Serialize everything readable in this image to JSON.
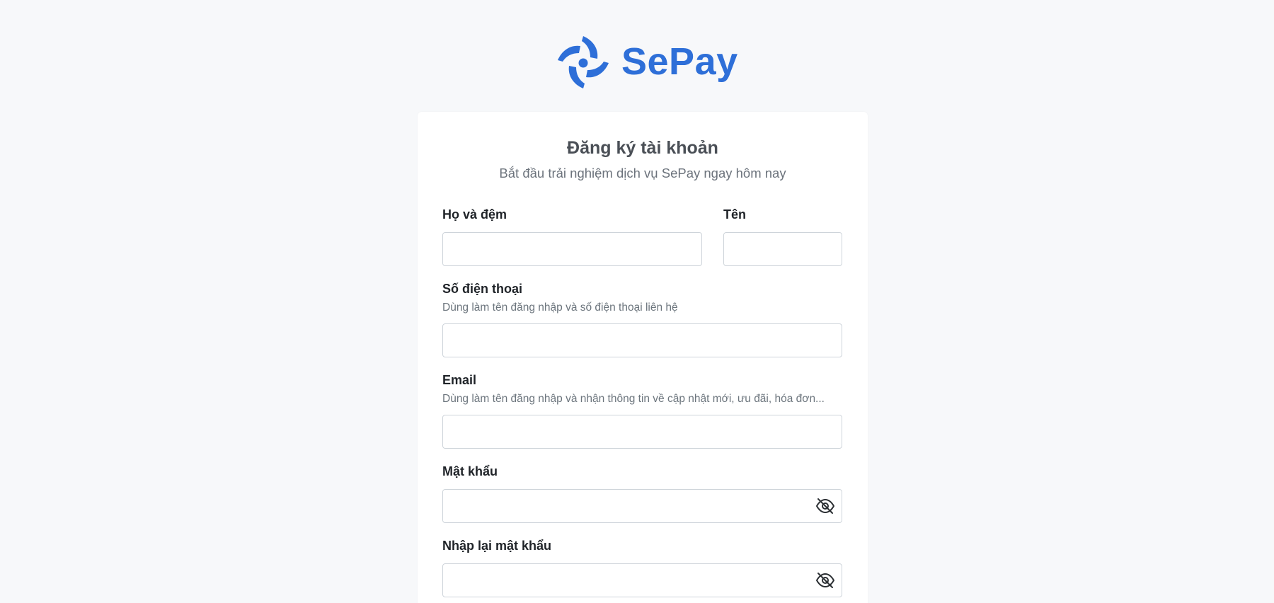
{
  "brand": {
    "name": "SePay",
    "color": "#2e6fd8"
  },
  "form": {
    "title": "Đăng ký tài khoản",
    "subtitle": "Bắt đầu trải nghiệm dịch vụ SePay ngay hôm nay",
    "fields": {
      "last_middle_name": {
        "label": "Họ và đệm",
        "value": ""
      },
      "first_name": {
        "label": "Tên",
        "value": ""
      },
      "phone": {
        "label": "Số điện thoại",
        "hint": "Dùng làm tên đăng nhập và số điện thoại liên hệ",
        "value": ""
      },
      "email": {
        "label": "Email",
        "hint": "Dùng làm tên đăng nhập và nhận thông tin về cập nhật mới, ưu đãi, hóa đơn...",
        "value": ""
      },
      "password": {
        "label": "Mật khẩu",
        "value": "",
        "icon": "eye-slash-icon"
      },
      "password_confirm": {
        "label": "Nhập lại mật khẩu",
        "value": "",
        "icon": "eye-slash-icon"
      }
    }
  }
}
